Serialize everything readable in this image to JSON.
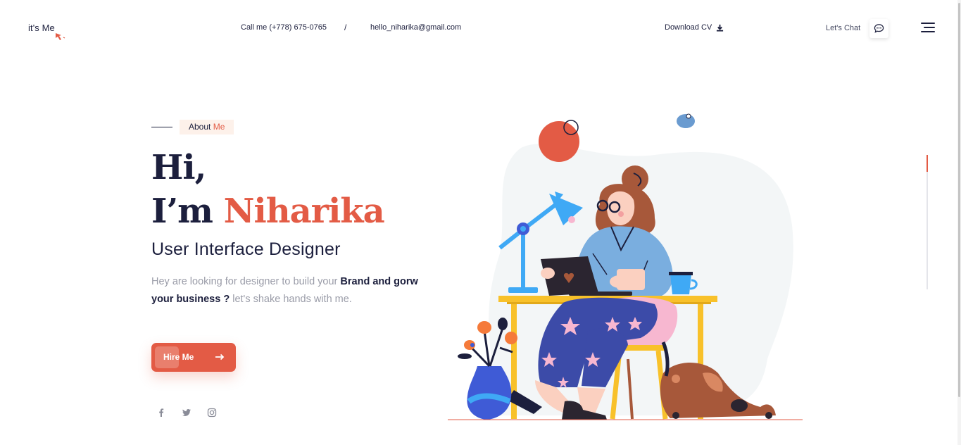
{
  "header": {
    "logo": "it's Me",
    "phone": "Call me (+778) 675-0765",
    "separator": "/",
    "email": "hello_niharika@gmail.com",
    "download_label": "Download CV",
    "chat_label": "Let's Chat"
  },
  "hero": {
    "tag_label": "About",
    "tag_accent": "Me",
    "greeting": "Hi,",
    "intro_prefix": "I’m",
    "name": "Niharika",
    "role": "User Interface Designer",
    "desc_part1": "Hey are looking for designer to build your ",
    "desc_bold": "Brand and gorw your business ?",
    "desc_part2": " let's shake hands with me.",
    "cta_label": "Hire Me"
  },
  "social": [
    "facebook-icon",
    "twitter-icon",
    "instagram-icon"
  ],
  "colors": {
    "accent": "#e35b45",
    "navy": "#1c1f3d",
    "muted": "#9a9ca8"
  }
}
